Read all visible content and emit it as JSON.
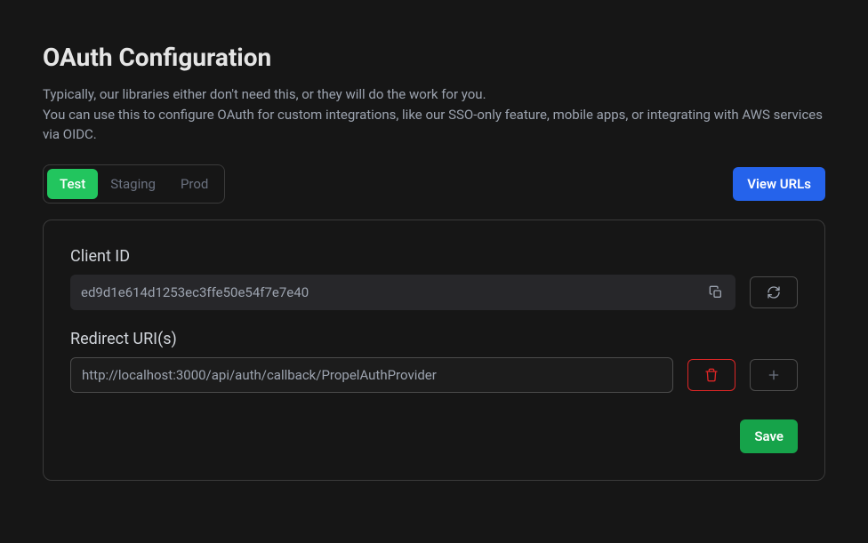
{
  "page": {
    "title": "OAuth Configuration",
    "description_line1": "Typically, our libraries either don't need this, or they will do the work for you.",
    "description_line2": "You can use this to configure OAuth for custom integrations, like our SSO-only feature, mobile apps, or integrating with AWS services via OIDC."
  },
  "tabs": {
    "test": "Test",
    "staging": "Staging",
    "prod": "Prod",
    "active": "test"
  },
  "actions": {
    "view_urls": "View URLs",
    "save": "Save"
  },
  "form": {
    "client_id_label": "Client ID",
    "client_id_value": "ed9d1e614d1253ec3ffe50e54f7e7e40",
    "redirect_label": "Redirect URI(s)",
    "redirect_uris": [
      "http://localhost:3000/api/auth/callback/PropelAuthProvider"
    ]
  },
  "icons": {
    "copy": "copy-icon",
    "refresh": "refresh-icon",
    "trash": "trash-icon",
    "plus": "plus-icon"
  },
  "colors": {
    "accent_green": "#22c55e",
    "accent_blue": "#2563eb",
    "danger": "#dc2626",
    "success": "#16a34a"
  }
}
